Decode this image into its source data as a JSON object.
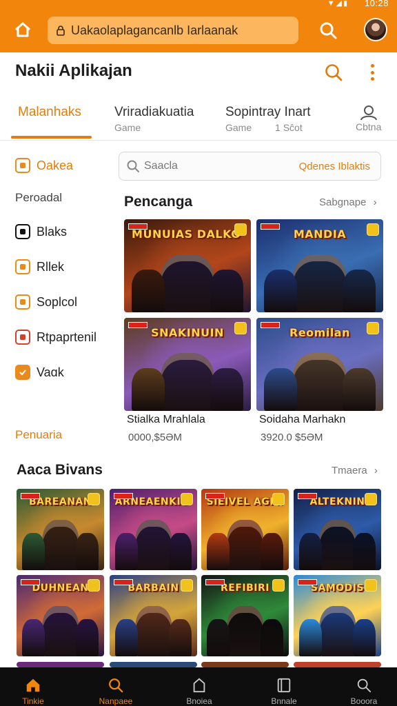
{
  "status_bar": {
    "clock": "10:28"
  },
  "browser": {
    "url": "Uakaolaplagancanlb Iarlaanak"
  },
  "header": {
    "title": "Nakii Aplikajan"
  },
  "tabs": [
    {
      "label": "Malanhaks",
      "sub": ""
    },
    {
      "label": "Vriradiakuatia",
      "sub": "Game"
    },
    {
      "label": "Sopintray Inart",
      "sub": "Game"
    },
    {
      "label": "",
      "sub": "Cbtna"
    }
  ],
  "tabs_extra": {
    "third_badge": "1 Sĉot"
  },
  "sidebar": {
    "top_item": "Oakea",
    "section_label": "Peroadal",
    "items": [
      {
        "label": "Blaks",
        "icon": "square-icon"
      },
      {
        "label": "Rllek",
        "icon": "square-icon"
      },
      {
        "label": "Soplcol",
        "icon": "check-square-icon"
      },
      {
        "label": "Rtpaprtenil",
        "icon": "square-icon"
      },
      {
        "label": "Vaɑk",
        "icon": "checked-box-icon"
      }
    ],
    "footer_link": "Penuaria"
  },
  "search": {
    "placeholder": "Saacla",
    "filter": "Qdenes Iblaktis"
  },
  "featured": {
    "title": "Pencanga",
    "link": "Sabgnape",
    "cards": [
      {
        "art_title": "MUNUIAS DALKO CALLS",
        "colors": [
          "#3a1a0d",
          "#b2461b",
          "#1e1531"
        ]
      },
      {
        "art_title": "MANDIA",
        "colors": [
          "#1b2f6e",
          "#3a6db2",
          "#16284b"
        ]
      },
      {
        "art_title": "SNAKINUIN",
        "colors": [
          "#5d3c1d",
          "#8a5ab8",
          "#2c1d44"
        ]
      },
      {
        "art_title": "Reomilan",
        "colors": [
          "#2d4c8b",
          "#6a6ec0",
          "#4c3a2c"
        ]
      }
    ],
    "games": [
      {
        "name": "Stialka Mrahlala",
        "price": "0000,$5ƏM"
      },
      {
        "name": "Soidaha Marhakn",
        "price": "3920.0 $5ƏM"
      }
    ]
  },
  "second_section": {
    "title": "Aaca Bivans",
    "link": "Tmaera",
    "cards": [
      {
        "art_title": "BAREANAN",
        "colors": [
          "#2c5a34",
          "#c7892f",
          "#3a2413"
        ]
      },
      {
        "art_title": "ARNEAENKIGS",
        "colors": [
          "#4d1f6b",
          "#c44b86",
          "#23143c"
        ]
      },
      {
        "art_title": "SIEIVEL AGMS",
        "colors": [
          "#b33a12",
          "#f0b12d",
          "#5a1a0a"
        ]
      },
      {
        "art_title": "ALTEKNIN",
        "colors": [
          "#132045",
          "#2e5aa8",
          "#0a1228"
        ]
      },
      {
        "art_title": "DUHNEAN",
        "colors": [
          "#4a2775",
          "#d16b36",
          "#281342"
        ]
      },
      {
        "art_title": "BARBAIN",
        "colors": [
          "#2a3f86",
          "#d4a43b",
          "#5a2c1a"
        ]
      },
      {
        "art_title": "REFIBIRI",
        "colors": [
          "#151515",
          "#2f8a3a",
          "#0b0b0b"
        ]
      },
      {
        "art_title": "SAMODIS",
        "colors": [
          "#2b89d9",
          "#ffd255",
          "#1a3f8a"
        ]
      }
    ]
  },
  "bottom_nav": [
    {
      "label": "Tinkie",
      "icon": "home-icon"
    },
    {
      "label": "Nanpaee",
      "icon": "search-icon"
    },
    {
      "label": "Bnoiea",
      "icon": "bag-icon"
    },
    {
      "label": "Bnnale",
      "icon": "book-icon"
    },
    {
      "label": "Booora",
      "icon": "magnifier-icon"
    }
  ],
  "theme": {
    "accent": "#f2860c",
    "accent_dark": "#e47d0d",
    "nav_bg": "#0e0e0e"
  }
}
